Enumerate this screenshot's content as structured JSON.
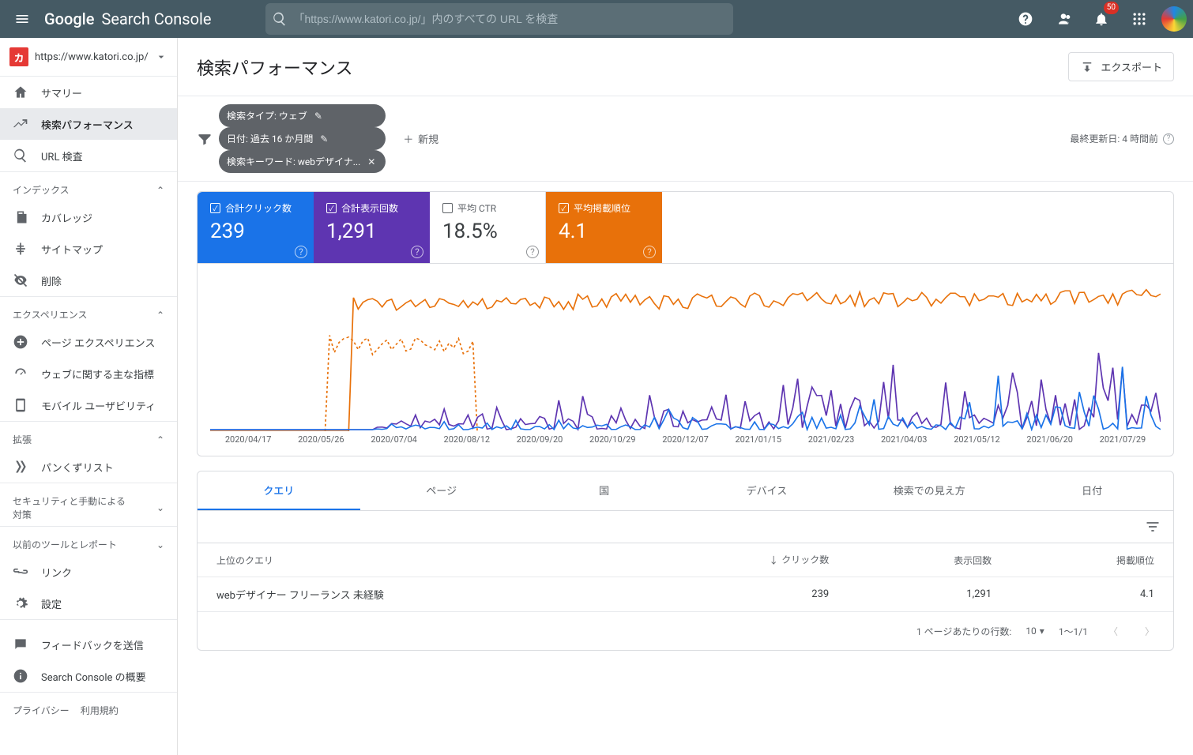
{
  "header": {
    "product_g": "Google",
    "product_name": "Search Console",
    "search_placeholder": "「https://www.katori.co.jp/」内のすべての URL を検査",
    "notif_count": "50"
  },
  "property": {
    "url": "https://www.katori.co.jp/",
    "icon_letter": "カ"
  },
  "sidebar": {
    "items_top": [
      {
        "label": "サマリー",
        "icon": "home"
      },
      {
        "label": "検索パフォーマンス",
        "icon": "trend",
        "selected": true
      },
      {
        "label": "URL 検査",
        "icon": "search"
      }
    ],
    "sec_index": "インデックス",
    "items_index": [
      {
        "label": "カバレッジ",
        "icon": "pages"
      },
      {
        "label": "サイトマップ",
        "icon": "sitemap"
      },
      {
        "label": "削除",
        "icon": "remove"
      }
    ],
    "sec_exp": "エクスペリエンス",
    "items_exp": [
      {
        "label": "ページ エクスペリエンス",
        "icon": "plus-circle"
      },
      {
        "label": "ウェブに関する主な指標",
        "icon": "speed"
      },
      {
        "label": "モバイル ユーザビリティ",
        "icon": "phone"
      }
    ],
    "sec_ext": "拡張",
    "items_ext": [
      {
        "label": "パンくずリスト",
        "icon": "breadcrumb"
      }
    ],
    "sec_sec": "セキュリティと手動による対策",
    "sec_old": "以前のツールとレポート",
    "items_bottom": [
      {
        "label": "リンク",
        "icon": "links"
      },
      {
        "label": "設定",
        "icon": "gear"
      }
    ],
    "items_foot": [
      {
        "label": "フィードバックを送信",
        "icon": "feedback"
      },
      {
        "label": "Search Console の概要",
        "icon": "info"
      }
    ],
    "privacy": "プライバシー",
    "terms": "利用規約"
  },
  "page": {
    "title": "検索パフォーマンス",
    "export": "エクスポート",
    "last_update_label": "最終更新日: 4 時間前",
    "add_new": "新規"
  },
  "chips": [
    {
      "label": "検索タイプ: ウェブ",
      "trailing": "edit"
    },
    {
      "label": "日付: 過去 16 か月間",
      "trailing": "edit"
    },
    {
      "label": "検索キーワード: webデザイナ...",
      "trailing": "close"
    }
  ],
  "metrics": [
    {
      "label": "合計クリック数",
      "value": "239",
      "color": "blue",
      "checked": true
    },
    {
      "label": "合計表示回数",
      "value": "1,291",
      "color": "purple",
      "checked": true
    },
    {
      "label": "平均 CTR",
      "value": "18.5%",
      "color": "white",
      "checked": false
    },
    {
      "label": "平均掲載順位",
      "value": "4.1",
      "color": "orange",
      "checked": true
    }
  ],
  "chart_data": {
    "type": "line",
    "x_categories": [
      "2020/04/17",
      "2020/05/26",
      "2020/07/04",
      "2020/08/12",
      "2020/09/20",
      "2020/10/29",
      "2020/12/07",
      "2021/01/15",
      "2021/02/23",
      "2021/04/03",
      "2021/05/12",
      "2021/06/20",
      "2021/07/29"
    ],
    "series": [
      {
        "name": "合計クリック数",
        "color": "#1a73e8",
        "kind": "spiky-low",
        "baseline": 0,
        "approx_peak": 6
      },
      {
        "name": "合計表示回数",
        "color": "#5e35b1",
        "kind": "spiky-mid",
        "baseline": 0,
        "approx_peak": 12
      },
      {
        "name": "平均掲載順位",
        "color": "#e8710a",
        "kind": "band-high",
        "approx_level_start": 6,
        "approx_level_end": 3,
        "note": "values shown inverted; lower rank plotted higher"
      }
    ],
    "ylabel": "",
    "xlabel": ""
  },
  "tabs": [
    "クエリ",
    "ページ",
    "国",
    "デバイス",
    "検索での見え方",
    "日付"
  ],
  "table": {
    "head_query": "上位のクエリ",
    "head_clicks": "クリック数",
    "head_impr": "表示回数",
    "head_pos": "掲載順位",
    "rows": [
      {
        "q": "webデザイナー フリーランス 未経験",
        "clicks": "239",
        "impr": "1,291",
        "pos": "4.1"
      }
    ],
    "rows_per_label": "1 ページあたりの行数:",
    "rows_per_value": "10",
    "range": "1～1/1"
  }
}
